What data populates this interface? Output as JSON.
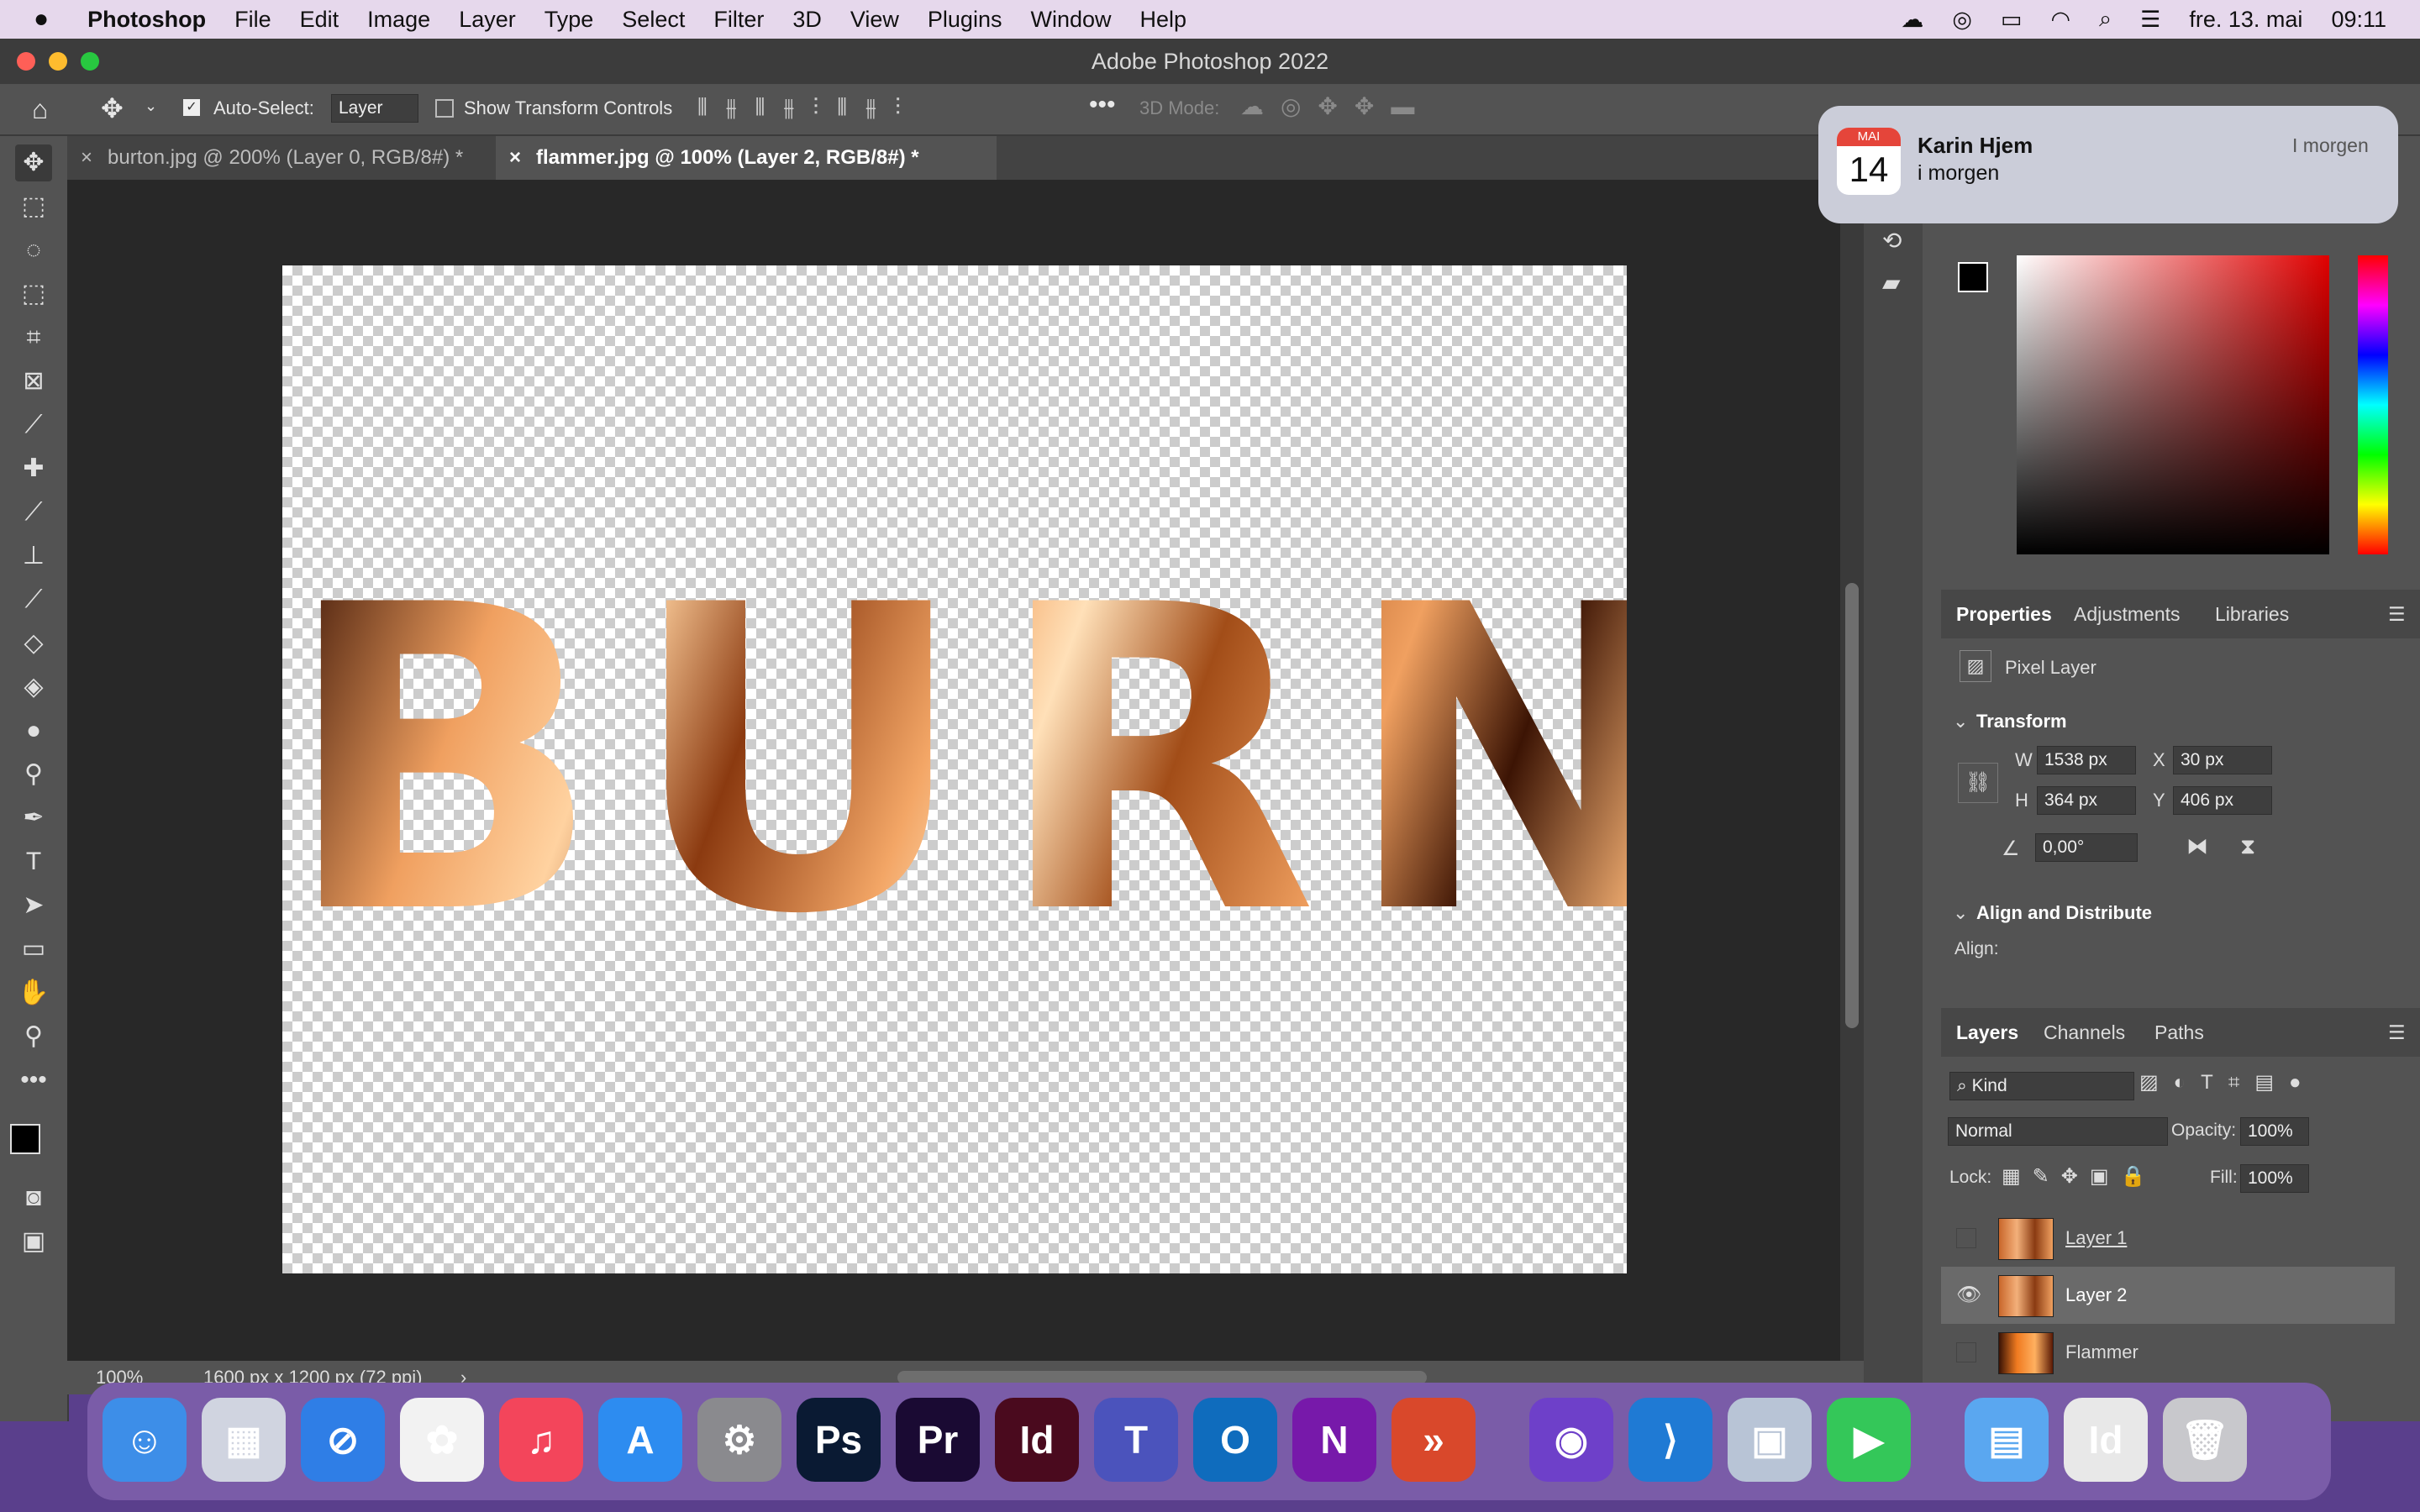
{
  "menubar": {
    "apple": "",
    "app": "Photoshop",
    "items": [
      "File",
      "Edit",
      "Image",
      "Layer",
      "Type",
      "Select",
      "Filter",
      "3D",
      "View",
      "Plugins",
      "Window",
      "Help"
    ],
    "date": "fre. 13. mai",
    "time": "09:11"
  },
  "window": {
    "title": "Adobe Photoshop 2022"
  },
  "options": {
    "auto_select_label": "Auto-Select:",
    "auto_select_value": "Layer",
    "show_transform_label": "Show Transform Controls",
    "mode_3d_label": "3D Mode:"
  },
  "tabs": [
    {
      "label": "burton.jpg @ 200% (Layer 0, RGB/8#) *",
      "close": "×"
    },
    {
      "label": "flammer.jpg @ 100% (Layer 2, RGB/8#) *",
      "close": "×"
    }
  ],
  "canvas": {
    "text": "BURN"
  },
  "status": {
    "zoom": "100%",
    "doc_size": "1600 px x 1200 px (72 ppi)",
    "arrow": "›"
  },
  "notification": {
    "month": "MAI",
    "day": "14",
    "title": "Karin Hjem",
    "body": "i morgen",
    "when": "I morgen"
  },
  "properties": {
    "tabs": [
      "Properties",
      "Adjustments",
      "Libraries"
    ],
    "layer_type": "Pixel Layer",
    "transform_label": "Transform",
    "w_label": "W",
    "w": "1538 px",
    "x_label": "X",
    "x": "30 px",
    "h_label": "H",
    "h": "364 px",
    "y_label": "Y",
    "y": "406 px",
    "angle": "0,00°",
    "align_label": "Align and Distribute",
    "align_sub": "Align:"
  },
  "layers_panel": {
    "tabs": [
      "Layers",
      "Channels",
      "Paths"
    ],
    "kind": "Kind",
    "blend": "Normal",
    "opacity_label": "Opacity:",
    "opacity": "100%",
    "lock_label": "Lock:",
    "fill_label": "Fill:",
    "fill": "100%",
    "layers": [
      {
        "name": "Layer 1",
        "visible": false
      },
      {
        "name": "Layer 2",
        "visible": true,
        "selected": true
      },
      {
        "name": "Flammer",
        "visible": false
      }
    ]
  },
  "dock": {
    "apps": [
      {
        "name": "Finder",
        "label": "☺",
        "color": "#3d8ee8"
      },
      {
        "name": "Launchpad",
        "label": "▦",
        "color": "#d0d4e0"
      },
      {
        "name": "Safari",
        "label": "⊘",
        "color": "#2f7ee6"
      },
      {
        "name": "Photos",
        "label": "✿",
        "color": "#f2f2f2"
      },
      {
        "name": "Music",
        "label": "♫",
        "color": "#f3455b"
      },
      {
        "name": "App Store",
        "label": "A",
        "color": "#2d8cf0"
      },
      {
        "name": "System Preferences",
        "label": "⚙",
        "color": "#8a8a8e"
      },
      {
        "name": "Photoshop",
        "label": "Ps",
        "color": "#0a1a33"
      },
      {
        "name": "Premiere Pro",
        "label": "Pr",
        "color": "#1a0a33"
      },
      {
        "name": "InDesign",
        "label": "Id",
        "color": "#4a0a1e"
      },
      {
        "name": "Teams",
        "label": "T",
        "color": "#4b53bc"
      },
      {
        "name": "Outlook",
        "label": "O",
        "color": "#0f6cbd"
      },
      {
        "name": "OneNote",
        "label": "N",
        "color": "#7719aa"
      },
      {
        "name": "Remote Desktop",
        "label": "»",
        "color": "#d9482b"
      },
      {
        "name": "GitHub Desktop",
        "label": "◉",
        "color": "#6e40c9"
      },
      {
        "name": "VS Code",
        "label": "⟩",
        "color": "#1f7ad4"
      },
      {
        "name": "Preview",
        "label": "▣",
        "color": "#b8c4d6"
      },
      {
        "name": "FaceTime",
        "label": "▶",
        "color": "#34c759"
      },
      {
        "name": "Downloads",
        "label": "▤",
        "color": "#5aa7f0"
      },
      {
        "name": "Recent",
        "label": "Id",
        "color": "#e8e8e8"
      },
      {
        "name": "Trash",
        "label": "🗑",
        "color": "#c8c8cc"
      }
    ]
  }
}
